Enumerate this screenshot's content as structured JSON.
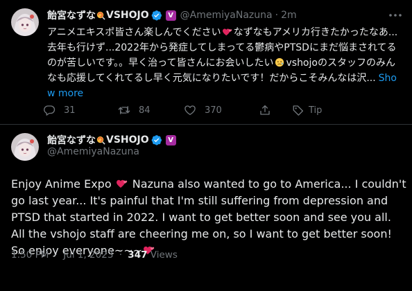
{
  "tweet1": {
    "display_name": "飴宮なずな",
    "brand": "VSHOJO",
    "handle": "@AmemiyaNazuna",
    "separator": "·",
    "time": "2m",
    "text_1": "アニメエキスポ皆さん楽しんでください",
    "text_2": "なずなもアメリカ行きたかったなあ...去年も行けず...2022年から発症してしまってる鬱病やPTSDにまだ悩まされてるのが苦しいです。。早く治って皆さんにお会いしたい",
    "text_3": "vshojoのスタッフのみんなも応援してくれてるし早く元気になりたいです！だからこそみんなは沢...",
    "show_more": "Show more",
    "stats": {
      "replies": "31",
      "retweets": "84",
      "likes": "370",
      "tip": "Tip"
    }
  },
  "tweet2": {
    "display_name": "飴宮なずな",
    "brand": "VSHOJO",
    "handle": "@AmemiyaNazuna",
    "text_main": "Enjoy Anime Expo ",
    "text_rest": " Nazuna also wanted to go to America... I couldn't go last year... It's painful that I'm still suffering from depression and PTSD that started in 2022. I want to get better soon and see you all. All the vshojo staff are cheering me on, so I want to get better soon! So enjoy everyone~~~",
    "time": "1:50 PM",
    "separator": "·",
    "date": "Jul 1, 2023",
    "views_count": "347",
    "views_label": "Views"
  },
  "colors": {
    "background": "#000000",
    "text": "#e7e9ea",
    "muted": "#71767b",
    "link": "#1d9bf0",
    "verified": "#1d9bf0",
    "vshojo_badge": "#a52ba0",
    "heart": "#e0245e"
  },
  "icons": [
    "avatar",
    "lollipop-icon",
    "verified-icon",
    "vshojo-badge",
    "more-icon",
    "heart-emoji",
    "worried-face-emoji",
    "reply-icon",
    "retweet-icon",
    "like-icon",
    "share-icon",
    "tip-icon"
  ]
}
